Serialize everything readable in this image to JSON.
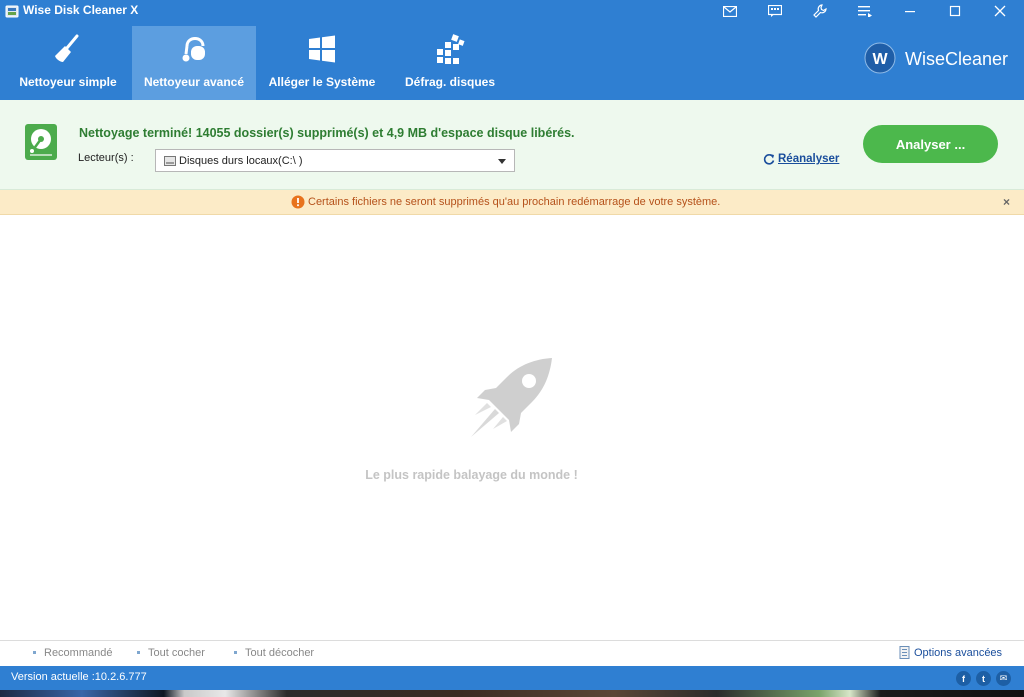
{
  "window": {
    "title": "Wise Disk Cleaner X"
  },
  "nav": {
    "tabs": [
      {
        "label": "Nettoyeur simple",
        "icon": "broom-icon"
      },
      {
        "label": "Nettoyeur avancé",
        "icon": "vacuum-icon",
        "active": true
      },
      {
        "label": "Alléger le Système",
        "icon": "windows-icon"
      },
      {
        "label": "Défrag. disques",
        "icon": "defrag-icon"
      }
    ]
  },
  "brand": {
    "logo_letter": "W",
    "name": "WiseCleaner"
  },
  "status": {
    "message": "Nettoyage terminé! 14055 dossier(s) supprimé(s) et 4,9 MB d'espace disque libérés.",
    "drive_label": "Lecteur(s) :",
    "drive_value": "Disques durs locaux(C:\\ )",
    "reanalyze_label": "Réanalyser",
    "analyze_button": "Analyser ..."
  },
  "warning": {
    "text": "Certains fichiers ne seront supprimés qu'au prochain redémarrage de votre système.",
    "close": "×"
  },
  "main": {
    "tagline": "Le plus rapide balayage du monde !"
  },
  "bottom_toolbar": {
    "recommended": "Recommandé",
    "check_all": "Tout cocher",
    "uncheck_all": "Tout décocher",
    "advanced_options": "Options avancées"
  },
  "statusbar": {
    "version": "Version actuelle :10.2.6.777",
    "social": [
      "f",
      "t",
      "✉"
    ]
  },
  "colors": {
    "primary": "#2f7fd2",
    "active_tab": "#5c9ee0",
    "success_text": "#2e7d32",
    "analyze_button": "#4cb84c",
    "warning_bg": "#fcebc7",
    "warning_text": "#b5511a",
    "link": "#1a4e9c"
  }
}
